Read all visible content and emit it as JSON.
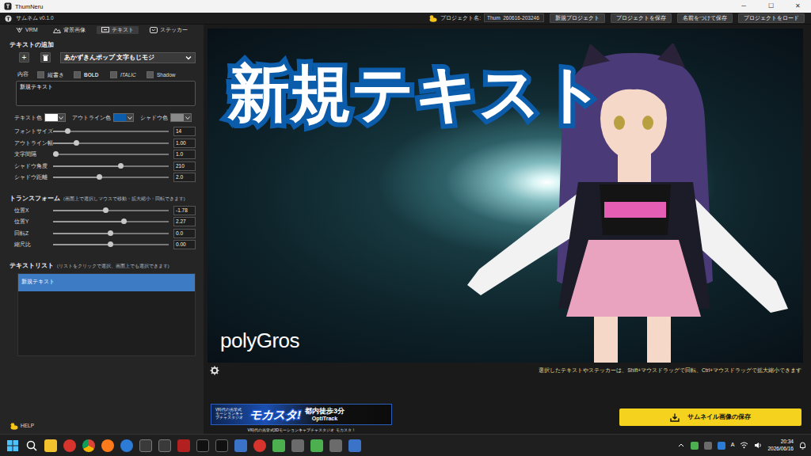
{
  "window": {
    "title": "ThumNeru",
    "controls": [
      "─",
      "☐",
      "✕"
    ]
  },
  "app_bar": {
    "title": "サムネム v0.1.0",
    "project_label": "プロジェクト名:",
    "project_name": "Thum_260616-203246",
    "buttons": [
      "新規プロジェクト",
      "プロジェクトを保存",
      "名前をつけて保存",
      "プロジェクトをロード"
    ]
  },
  "left_tabs": [
    {
      "label": "VRM",
      "selected": false
    },
    {
      "label": "背景画像",
      "selected": false
    },
    {
      "label": "テキスト",
      "selected": true
    },
    {
      "label": "ステッカー",
      "selected": false
    }
  ],
  "text_panel": {
    "add_label": "テキストの追加",
    "add_button": "+",
    "font": "あかずきんポップ 文字もじモジ",
    "content_label": "内容",
    "toggles": [
      {
        "label": "縦書き",
        "checked": false
      },
      {
        "label": "BOLD",
        "checked": false
      },
      {
        "label": "ITALIC",
        "checked": false
      },
      {
        "label": "Shadow",
        "checked": false
      }
    ],
    "content_value": "新規テキスト",
    "colors": [
      {
        "label": "テキスト色",
        "color": "#ffffff"
      },
      {
        "label": "アウトライン色",
        "color": "#0b5cab"
      },
      {
        "label": "シャドウ色",
        "color": "#8a8a8a"
      }
    ],
    "sliders": [
      {
        "label": "フォントサイズ",
        "value": "14",
        "level": 0.12
      },
      {
        "label": "アウトライン幅",
        "value": "1.00",
        "level": 0.2
      },
      {
        "label": "文字間隔",
        "value": "1.0",
        "level": 0.02
      },
      {
        "label": "シャドウ角度",
        "value": "210",
        "level": 0.58
      },
      {
        "label": "シャドウ距離",
        "value": "2.0",
        "level": 0.4
      }
    ],
    "transform_title": "トランスフォーム",
    "transform_hint": "(画面上で選択しマウスで移動・拡大縮小・回転できます)",
    "transform": [
      {
        "label": "位置X",
        "value": "-1.78",
        "level": 0.45
      },
      {
        "label": "位置Y",
        "value": "2.27",
        "level": 0.61
      },
      {
        "label": "回転Z",
        "value": "0.0",
        "level": 0.49
      },
      {
        "label": "縮尺比",
        "value": "0.00",
        "level": 0.49
      }
    ],
    "list_title": "テキストリスト",
    "list_hint": "(リストをクリックで選択、画面上でも選択できます)",
    "list": [
      {
        "label": "新規テキスト",
        "selected": true
      }
    ]
  },
  "help": "HELP",
  "canvas": {
    "overlay_text": "新規テキスト",
    "watermark": "polyGros"
  },
  "hint": "選択したテキストやステッカーは、Shift+マウスドラッグで回転、Ctrl+マウスドラッグで拡大縮小できます",
  "banner": {
    "tagline": "V時代の光学式 モーションキャプチャスタジオ",
    "main": "モカスタ!",
    "side_top": "都内徒歩3分",
    "side_bottom": "OptiTrack",
    "caption": "V時代の光学式3Dモーションキャプチャスタジオ モカスタ！"
  },
  "save_button": "サムネイル画像の保存",
  "taskbar": {
    "ime": "A",
    "time": "20:34",
    "date": "2026/06/16"
  }
}
